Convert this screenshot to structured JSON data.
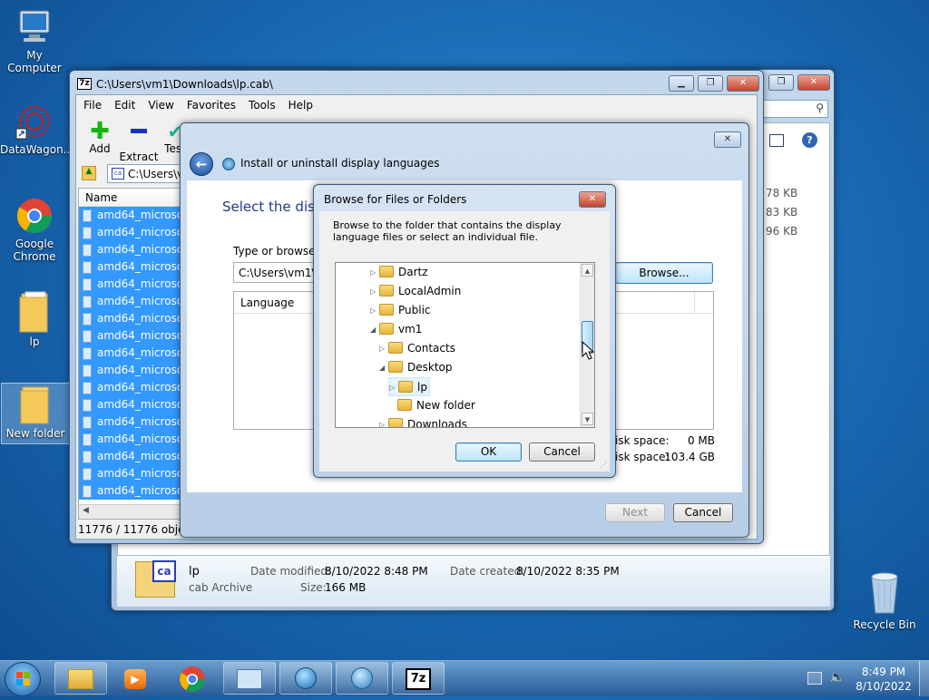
{
  "desktop": {
    "icons": [
      {
        "label": "My Computer"
      },
      {
        "label": "DataWagon..."
      },
      {
        "label": "Google Chrome"
      },
      {
        "label": "lp"
      },
      {
        "label": "New folder"
      },
      {
        "label": "Recycle Bin"
      }
    ]
  },
  "sevenzip": {
    "title": "C:\\Users\\vm1\\Downloads\\lp.cab\\",
    "menu": [
      "File",
      "Edit",
      "View",
      "Favorites",
      "Tools",
      "Help"
    ],
    "toolbar": {
      "add": "Add",
      "extract": "Extract",
      "test": "Test"
    },
    "address": "C:\\Users\\vm1",
    "column_name": "Name",
    "file_name_fragment": "amd64_microsoft",
    "row_count": 17,
    "status": "11776 / 11776 object(s"
  },
  "explorer_back": {
    "sizes": [
      "78 KB",
      "83 KB",
      "96 KB"
    ],
    "details": {
      "name": "lp",
      "type": "cab Archive",
      "modified_label": "Date modified:",
      "modified": "8/10/2022 8:48 PM",
      "created_label": "Date created:",
      "created": "8/10/2022 8:35 PM",
      "size_label": "Size:",
      "size": "166 MB"
    }
  },
  "wizard": {
    "title": "Install or uninstall display languages",
    "heading": "Select the disp",
    "prompt": "Type or browse t",
    "path_value": "C:\\Users\\vm1\\D",
    "browse": "Browse...",
    "column_language": "Language",
    "disk_space_label_1": "isk space:",
    "disk_space_value_1": "0 MB",
    "disk_space_label_2": "isk space:",
    "disk_space_value_2": "103.4 GB",
    "next": "Next",
    "cancel": "Cancel"
  },
  "browse_dialog": {
    "title": "Browse for Files or Folders",
    "instruction": "Browse to the folder that contains the display language files or select an individual file.",
    "tree": [
      {
        "label": "Dartz",
        "indent": 0,
        "expander": "right"
      },
      {
        "label": "LocalAdmin",
        "indent": 0,
        "expander": "right"
      },
      {
        "label": "Public",
        "indent": 0,
        "expander": "right"
      },
      {
        "label": "vm1",
        "indent": 0,
        "expander": "down"
      },
      {
        "label": "Contacts",
        "indent": 1,
        "expander": "right"
      },
      {
        "label": "Desktop",
        "indent": 1,
        "expander": "down"
      },
      {
        "label": "lp",
        "indent": 2,
        "expander": "right"
      },
      {
        "label": "New folder",
        "indent": 2,
        "expander": "none"
      },
      {
        "label": "Downloads",
        "indent": 1,
        "expander": "right"
      }
    ],
    "ok": "OK",
    "cancel": "Cancel"
  },
  "taskbar": {
    "time": "8:49 PM",
    "date": "8/10/2022",
    "apps": [
      "explorer",
      "media-player",
      "chrome",
      "control-panel",
      "network",
      "language-installer",
      "7zip"
    ]
  }
}
